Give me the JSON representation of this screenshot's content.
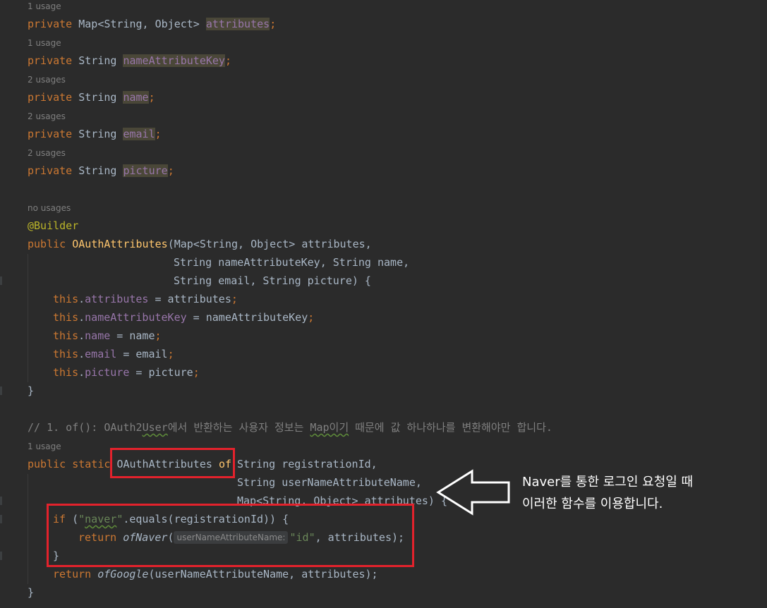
{
  "hints": {
    "h1": "1 usage",
    "h2": "1 usage",
    "h3": "2 usages",
    "h4": "2 usages",
    "h5": "2 usages",
    "h6": "no usages",
    "h7": "1 usage"
  },
  "code": {
    "kw_private": "private",
    "kw_public": "public",
    "kw_static": "static",
    "kw_this": "this",
    "kw_if": "if",
    "kw_return": "return",
    "t_map_so": "Map<String, Object>",
    "t_string": "String",
    "f_attributes": "attributes",
    "f_nameAttributeKey": "nameAttributeKey",
    "f_name": "name",
    "f_email": "email",
    "f_picture": "picture",
    "annotation": "@Builder",
    "ctor_name": "OAuthAttributes",
    "ctor_p1": "(Map<String, Object> attributes,",
    "ctor_p2": "String nameAttributeKey, String name,",
    "ctor_p3": "String email, String picture) {",
    "assign_attributes": " = attributes",
    "assign_nameAttributeKey": " = nameAttributeKey",
    "assign_name": " = name",
    "assign_email": " = email",
    "assign_picture": " = picture",
    "semi": ";",
    "dot": ".",
    "close_brace": "}",
    "comment_a": "// 1. of(): OAuth2",
    "comment_b": "User",
    "comment_c": "에서 반환하는 사용자 정보는 ",
    "comment_d": "Map",
    "comment_e": "이기",
    "comment_f": " 때문에 값 하나하나를 변환해야만 합니다.",
    "m_return_type": "OAuthAttributes",
    "m_name": "of",
    "m_p1": "String registrationId,",
    "m_p2": "String userNameAttributeName,",
    "m_p3": "Map<String, Object> attributes) {",
    "if_open": " (",
    "str_naver_q1": "\"",
    "str_naver": "naver",
    "str_naver_q2": "\"",
    "if_rest": ".equals(registrationId)) {",
    "call_ofNaver": "ofNaver",
    "paren_open": "(",
    "param_hint": "userNameAttributeName:",
    "str_id": "\"id\"",
    "call_rest": ", attributes);",
    "call_ofGoogle": "ofGoogle",
    "google_args": "(userNameAttributeName, attributes);"
  },
  "callout": {
    "line1": "Naver를 통한 로그인 요청일 때",
    "line2": "이러한 함수를 이용합니다."
  },
  "colors": {
    "background": "#2b2b2b",
    "keyword": "#cc7832",
    "field": "#9876aa",
    "function": "#ffc66d",
    "string": "#6a8759",
    "comment": "#808080",
    "highlight": "#e3222c"
  }
}
